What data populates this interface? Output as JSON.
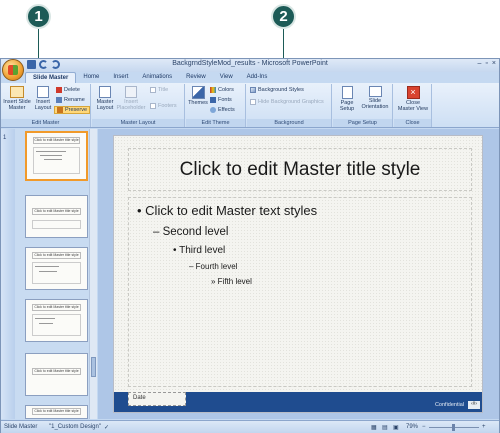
{
  "callouts": [
    "1",
    "2"
  ],
  "window": {
    "title": "BackgrndStyleMod_results - Microsoft PowerPoint",
    "controls": [
      "–",
      "▫",
      "×"
    ]
  },
  "tabs": [
    "Slide Master",
    "Home",
    "Insert",
    "Animations",
    "Review",
    "View",
    "Add-Ins"
  ],
  "ribbon": {
    "edit_master": {
      "label": "Edit Master",
      "insert_slide_master": "Insert Slide Master",
      "insert_layout": "Insert Layout",
      "delete": "Delete",
      "rename": "Rename",
      "preserve": "Preserve"
    },
    "master_layout": {
      "label": "Master Layout",
      "master_layout": "Master Layout",
      "insert_placeholder": "Insert Placeholder",
      "title": "Title",
      "footers": "Footers"
    },
    "edit_theme": {
      "label": "Edit Theme",
      "themes": "Themes",
      "colors": "Colors",
      "fonts": "Fonts",
      "effects": "Effects"
    },
    "background": {
      "label": "Background",
      "background_styles": "Background Styles",
      "hide_background_graphics": "Hide Background Graphics"
    },
    "page_setup": {
      "label": "Page Setup",
      "page_setup": "Page Setup",
      "slide_orientation": "Slide Orientation"
    },
    "close": {
      "label": "Close",
      "close_master_view": "Close Master View"
    }
  },
  "thumbnails": [
    {
      "num": "1",
      "title": "Click to edit Master title style",
      "selected": true
    },
    {
      "num": "",
      "title": "Click to edit Master title style",
      "selected": false
    },
    {
      "num": "",
      "title": "Click to edit Master title style",
      "selected": false
    },
    {
      "num": "",
      "title": "Click to edit Master title style",
      "selected": false
    },
    {
      "num": "",
      "title": "Click to edit Master title style",
      "selected": false
    },
    {
      "num": "",
      "title": "Click to edit Master title style",
      "selected": false
    }
  ],
  "slide": {
    "title": "Click to edit Master title style",
    "level1": "Click to edit Master text styles",
    "level2": "Second level",
    "level3": "Third level",
    "level4": "Fourth level",
    "level5": "Fifth level",
    "date": "Date",
    "confidential": "Confidential",
    "slide_number": "‹#›"
  },
  "status": {
    "mode": "Slide Master",
    "design": "\"1_Custom Design\"",
    "zoom": "79%"
  },
  "colors": {
    "ribbon_bg": "#dce8f7",
    "accent_orange": "#f19a2a",
    "slide_footer": "#1f4c8f",
    "callout": "#1d5b57"
  }
}
